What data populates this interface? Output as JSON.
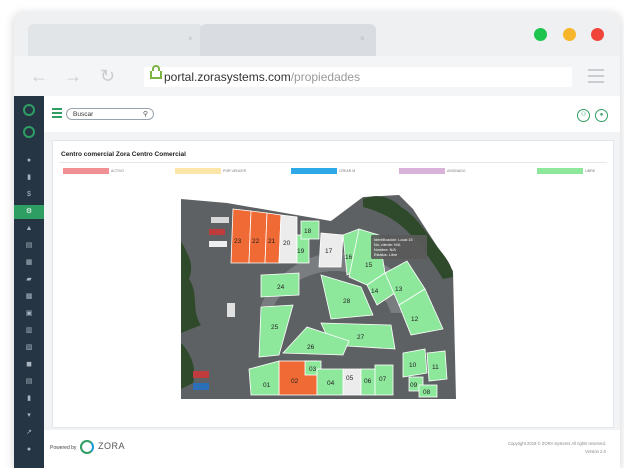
{
  "browser": {
    "tabs": [
      {
        "close": "×"
      },
      {
        "close": "×"
      }
    ],
    "url_host": "portal.zorasystems.com",
    "url_path": "/propiedades",
    "dots": [
      "#1cc44e",
      "#f7b52b",
      "#f0463a"
    ]
  },
  "search": {
    "placeholder": "Buscar"
  },
  "card": {
    "title": "Centro comercial Zora Centro Comercial"
  },
  "legend": [
    {
      "label": "ACTIVO",
      "color": "#f08f94"
    },
    {
      "label": "POR VENCER",
      "color": "#fbe6a8"
    },
    {
      "label": "CREAR M",
      "color": "#2ea8e6"
    },
    {
      "label": "ASIGNADO",
      "color": "#d8b2d9"
    },
    {
      "label": "LIBRE",
      "color": "#8ee89c"
    }
  ],
  "lots": {
    "l01": "01",
    "l02": "02",
    "l03": "03",
    "l04": "04",
    "l05": "05",
    "l06": "06",
    "l07": "07",
    "l08": "08",
    "l09": "09",
    "l10": "10",
    "l11": "11",
    "l12": "12",
    "l13": "13",
    "l14": "14",
    "l15": "15",
    "l16": "16",
    "l17": "17",
    "l18": "18",
    "l19": "19",
    "l20": "20",
    "l21": "21",
    "l22": "22",
    "l23": "23",
    "l24": "24",
    "l25": "25",
    "l26": "26",
    "l27": "27",
    "l28": "28"
  },
  "tooltip": {
    "line1": "Identificación: Local 15",
    "line2": "No. cliente: N/A",
    "line3": "Nombre: N/A",
    "line4": "Estatus: Libre"
  },
  "footer": {
    "powered": "Powered by",
    "brand": "ZORA",
    "copyright": "Copyright 2018 © ZORA Systems All rights reserved.",
    "version": "Versión 2.0"
  },
  "colors": {
    "sidebar": "#253544",
    "accent": "#2f9e63",
    "libre": "#8ee89c",
    "activo_orange": "#f06a35"
  }
}
